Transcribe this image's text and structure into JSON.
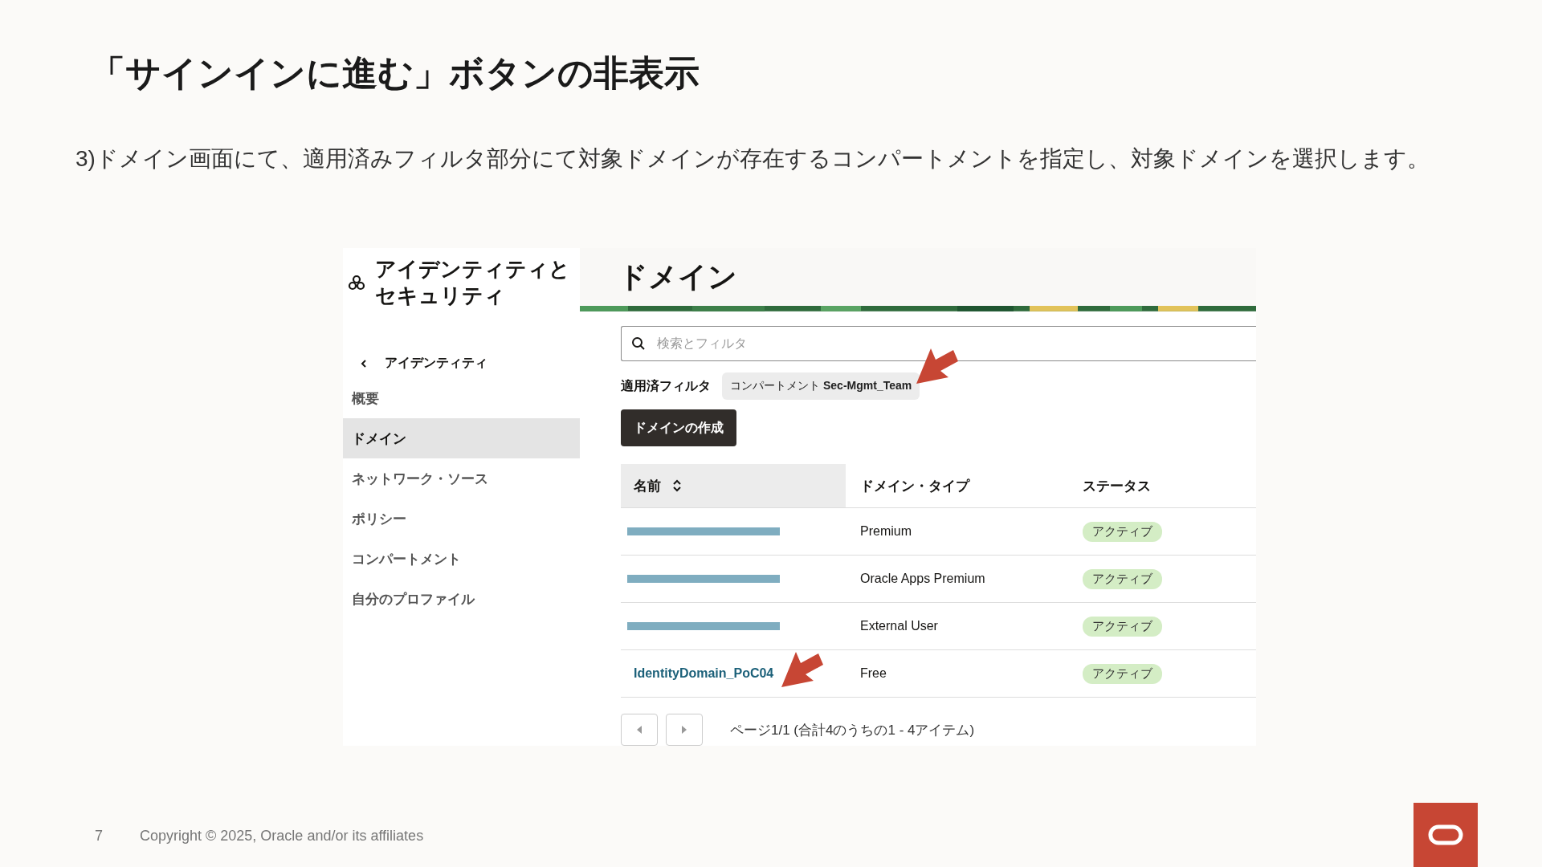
{
  "slide": {
    "title": "「サインインに進む」ボタンの非表示",
    "instruction": "3)ドメイン画面にて、適用済みフィルタ部分にて対象ドメインが存在するコンパートメントを指定し、対象ドメインを選択します。",
    "page_number": "7",
    "copyright": "Copyright © 2025, Oracle and/or its affiliates"
  },
  "console": {
    "sidebar": {
      "title": "アイデンティティとセキュリティ",
      "back": "アイデンティティ",
      "items": [
        {
          "label": "概要",
          "selected": false
        },
        {
          "label": "ドメイン",
          "selected": true
        },
        {
          "label": "ネットワーク・ソース",
          "selected": false
        },
        {
          "label": "ポリシー",
          "selected": false
        },
        {
          "label": "コンパートメント",
          "selected": false
        },
        {
          "label": "自分のプロファイル",
          "selected": false
        }
      ]
    },
    "page_title": "ドメイン",
    "search": {
      "placeholder": "検索とフィルタ"
    },
    "filters": {
      "label": "適用済フィルタ",
      "chips": [
        {
          "name": "コンパートメント",
          "value": "Sec-Mgmt_Team",
          "pointed": true
        }
      ]
    },
    "create_button": "ドメインの作成",
    "table": {
      "columns": [
        {
          "label": "名前",
          "sortable": true
        },
        {
          "label": "ドメイン・タイプ",
          "sortable": false
        },
        {
          "label": "ステータス",
          "sortable": false
        }
      ],
      "rows": [
        {
          "redacted": true,
          "type": "Premium",
          "status": "アクティブ",
          "pointed": false
        },
        {
          "redacted": true,
          "type": "Oracle Apps Premium",
          "status": "アクティブ",
          "pointed": false
        },
        {
          "redacted": true,
          "type": "External User",
          "status": "アクティブ",
          "pointed": false
        },
        {
          "redacted": false,
          "name": "IdentityDomain_PoC04",
          "type": "Free",
          "status": "アクティブ",
          "pointed": true
        }
      ]
    },
    "pagination": "ページ1/1 (合計4のうちの1 - 4アイテム)"
  }
}
